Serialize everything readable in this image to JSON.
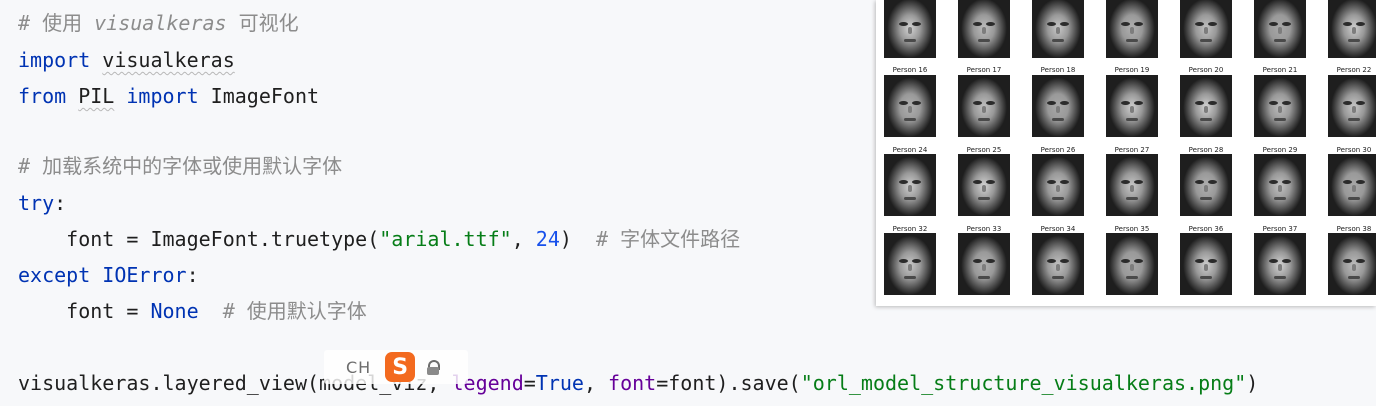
{
  "code_lines": [
    {
      "segments": [
        {
          "t": "# 使用 ",
          "c": "cmt"
        },
        {
          "t": "visualkeras",
          "c": "cmt cmt-it"
        },
        {
          "t": " 可视化",
          "c": "cmt"
        }
      ]
    },
    {
      "segments": [
        {
          "t": "import",
          "c": "kw"
        },
        {
          "t": " ",
          "c": "plain"
        },
        {
          "t": "visualkeras",
          "c": "plain squig"
        }
      ]
    },
    {
      "segments": [
        {
          "t": "from",
          "c": "kw"
        },
        {
          "t": " ",
          "c": "plain"
        },
        {
          "t": "PIL",
          "c": "plain squig"
        },
        {
          "t": " ",
          "c": "plain"
        },
        {
          "t": "import",
          "c": "kw"
        },
        {
          "t": " ImageFont",
          "c": "plain"
        }
      ]
    },
    {
      "segments": []
    },
    {
      "segments": [
        {
          "t": "# 加载系统中的字体或使用默认字体",
          "c": "cmt"
        }
      ]
    },
    {
      "segments": [
        {
          "t": "try",
          "c": "kw"
        },
        {
          "t": ":",
          "c": "plain"
        }
      ]
    },
    {
      "segments": [
        {
          "t": "    font = ImageFont.truetype(",
          "c": "plain"
        },
        {
          "t": "\"arial.ttf\"",
          "c": "str"
        },
        {
          "t": ", ",
          "c": "plain"
        },
        {
          "t": "24",
          "c": "num"
        },
        {
          "t": ")  ",
          "c": "plain"
        },
        {
          "t": "# 字体文件路径",
          "c": "cmt"
        }
      ]
    },
    {
      "segments": [
        {
          "t": "except",
          "c": "kw"
        },
        {
          "t": " ",
          "c": "plain"
        },
        {
          "t": "IOError",
          "c": "kw"
        },
        {
          "t": ":",
          "c": "plain"
        }
      ]
    },
    {
      "segments": [
        {
          "t": "    font = ",
          "c": "plain"
        },
        {
          "t": "None",
          "c": "kw"
        },
        {
          "t": "  ",
          "c": "plain"
        },
        {
          "t": "# 使用默认字体",
          "c": "cmt"
        }
      ]
    },
    {
      "segments": []
    },
    {
      "segments": [
        {
          "t": "visualkeras.layered_view(model_viz, ",
          "c": "plain"
        },
        {
          "t": "legend",
          "c": "param"
        },
        {
          "t": "=",
          "c": "plain"
        },
        {
          "t": "True",
          "c": "kw"
        },
        {
          "t": ", ",
          "c": "plain"
        },
        {
          "t": "font",
          "c": "param"
        },
        {
          "t": "=font).save(",
          "c": "plain"
        },
        {
          "t": "\"orl_model_structure_visualkeras.png\"",
          "c": "str"
        },
        {
          "t": ")",
          "c": "plain"
        }
      ]
    }
  ],
  "ime": {
    "mode": "CH",
    "logo": "S",
    "lock_icon": "lock-icon"
  },
  "face_grid": {
    "labels": [
      "Person 16",
      "Person 17",
      "Person 18",
      "Person 19",
      "Person 20",
      "Person 21",
      "Person 22",
      "Person 24",
      "Person 25",
      "Person 26",
      "Person 27",
      "Person 28",
      "Person 29",
      "Person 30",
      "Person 32",
      "Person 33",
      "Person 34",
      "Person 35",
      "Person 36",
      "Person 37",
      "Person 38"
    ],
    "rows": 4,
    "cols": 7
  }
}
